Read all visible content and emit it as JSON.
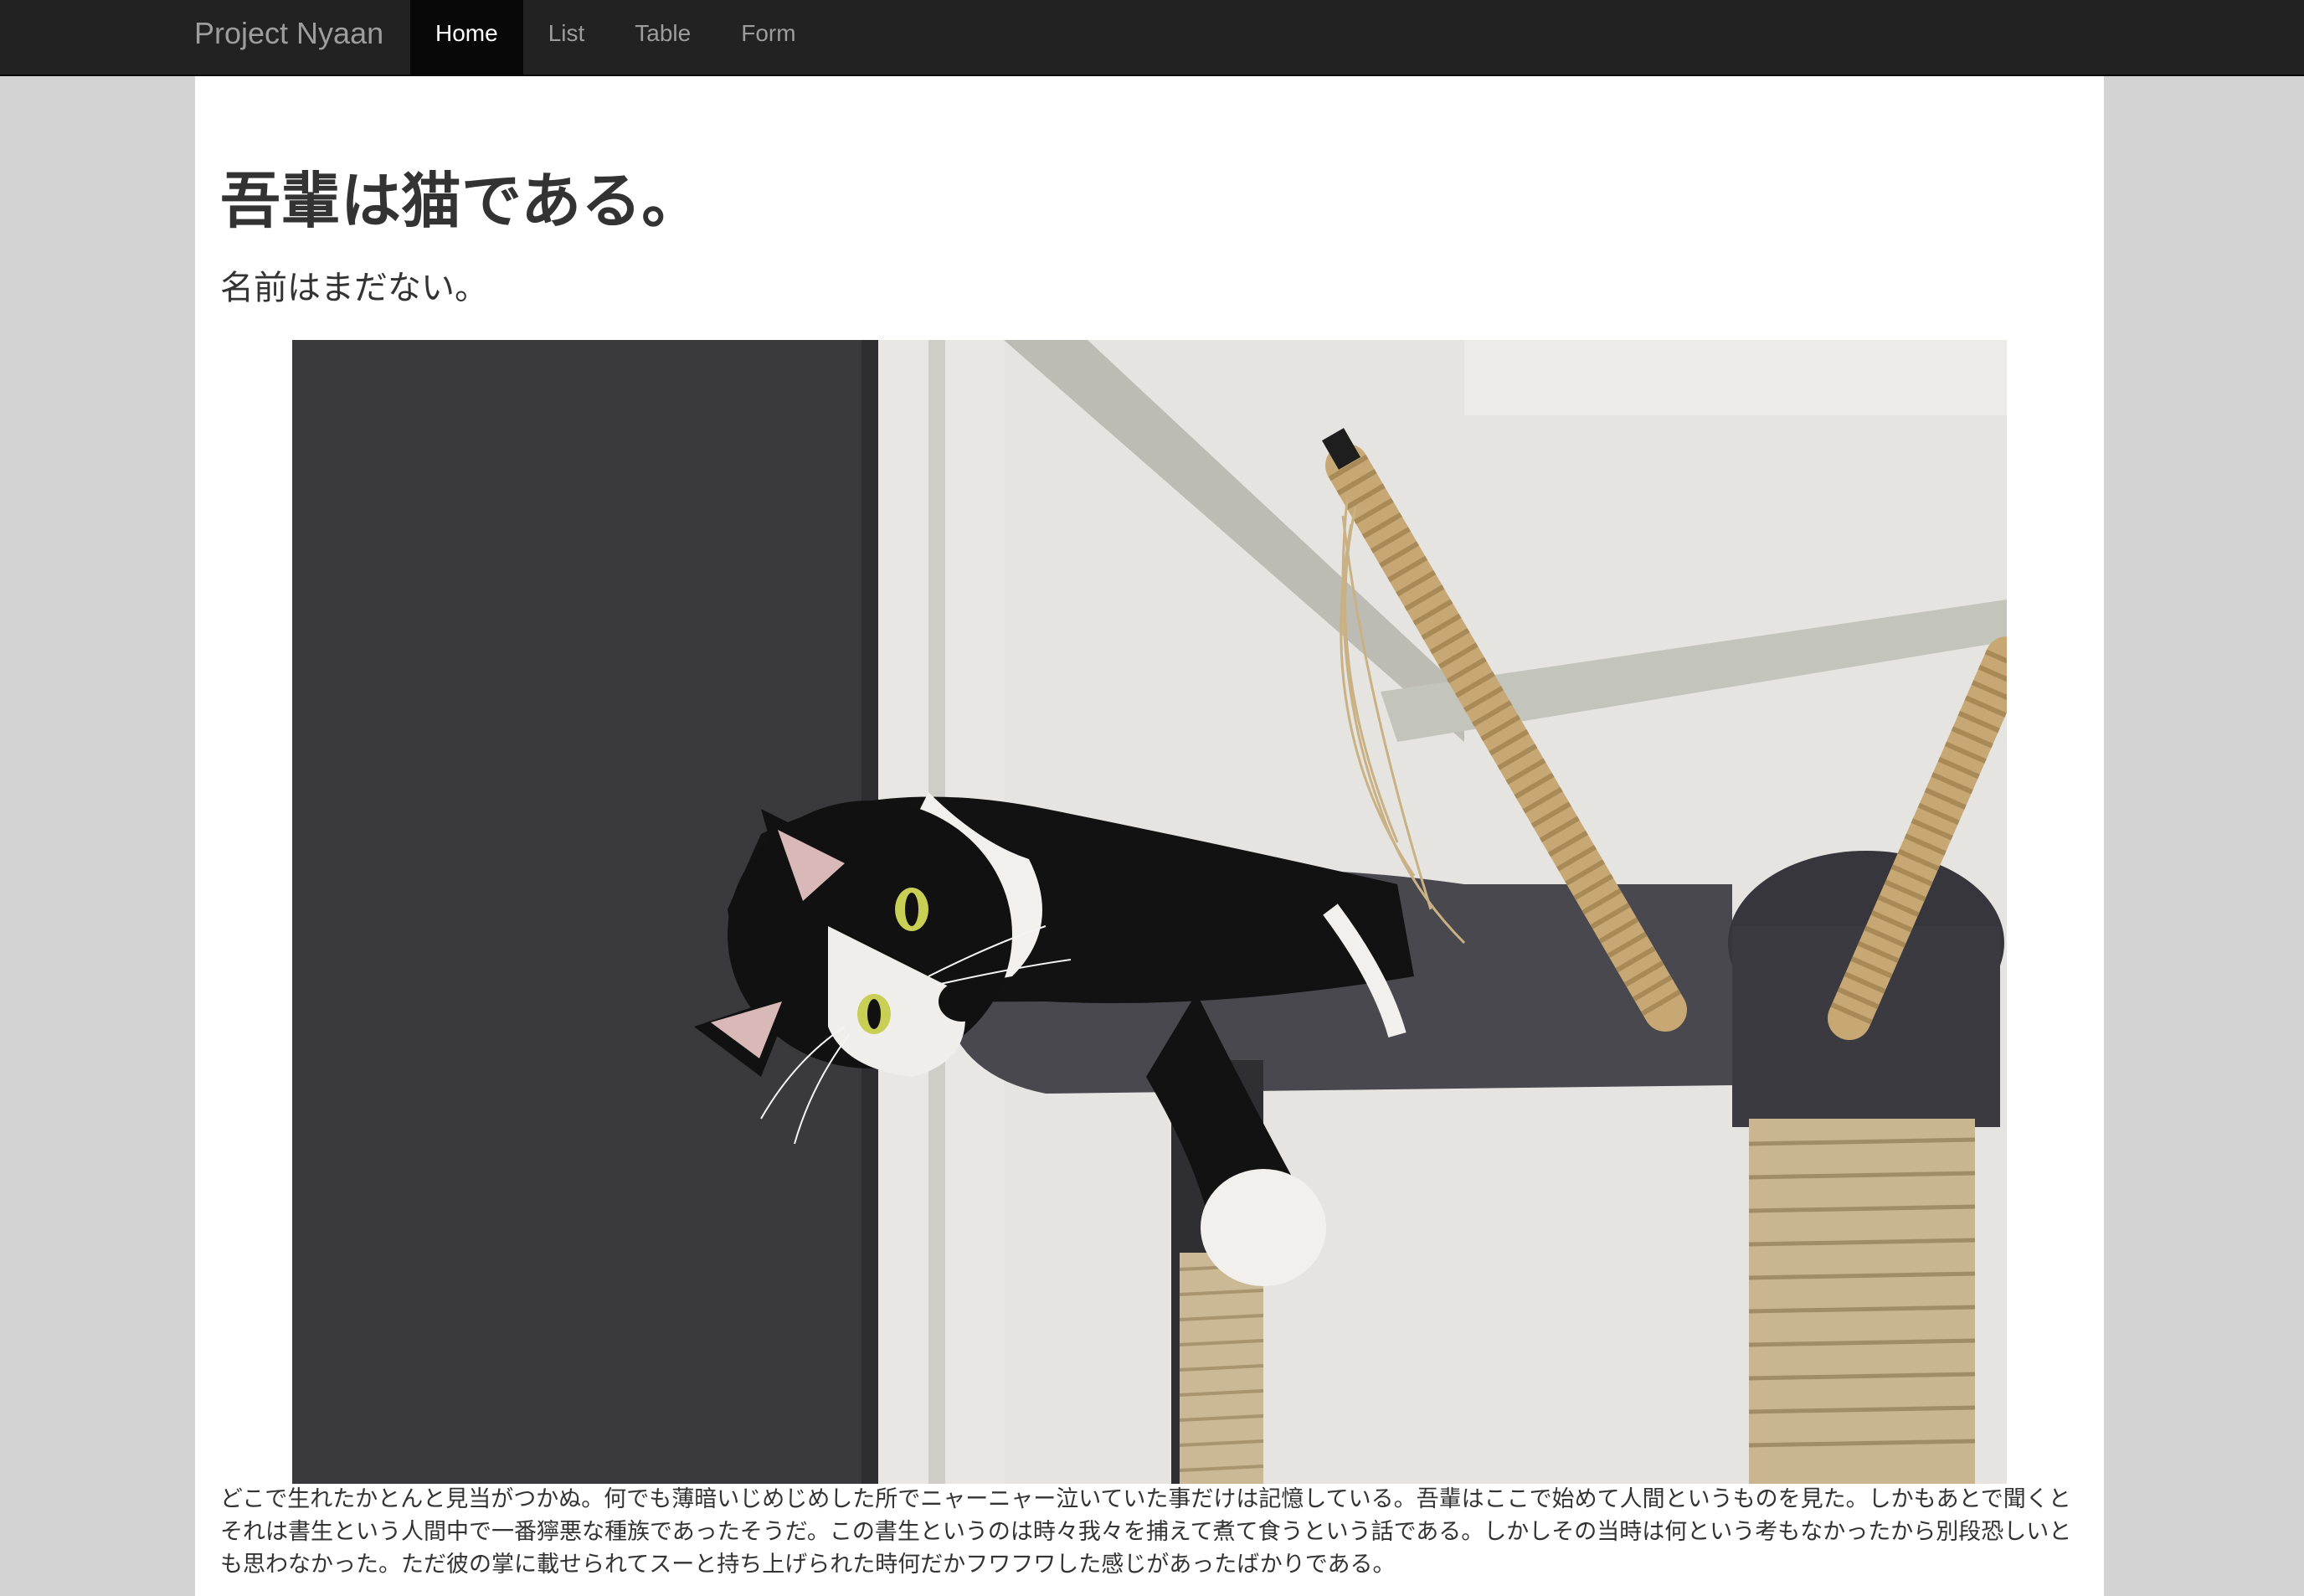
{
  "navbar": {
    "brand": "Project Nyaan",
    "items": [
      {
        "label": "Home",
        "active": true
      },
      {
        "label": "List",
        "active": false
      },
      {
        "label": "Table",
        "active": false
      },
      {
        "label": "Form",
        "active": false
      }
    ]
  },
  "main": {
    "title": "吾輩は猫である。",
    "subtitle": "名前はまだない。",
    "image_subject": "black-and-white cat lying on cat tower",
    "body_text": "どこで生れたかとんと見当がつかぬ。何でも薄暗いじめじめした所でニャーニャー泣いていた事だけは記憶している。吾輩はここで始めて人間というものを見た。しかもあとで聞くとそれは書生という人間中で一番獰悪な種族であったそうだ。この書生というのは時々我々を捕えて煮て食うという話である。しかしその当時は何という考もなかったから別段恐しいとも思わなかった。ただ彼の掌に載せられてスーと持ち上げられた時何だかフワフワした感じがあったばかりである。"
  },
  "colors": {
    "navbar_bg": "#222222",
    "navbar_text": "#9d9d9d",
    "navbar_active_bg": "#080808",
    "page_bg": "#d3d3d3",
    "content_bg": "#ffffff",
    "text": "#333333"
  }
}
